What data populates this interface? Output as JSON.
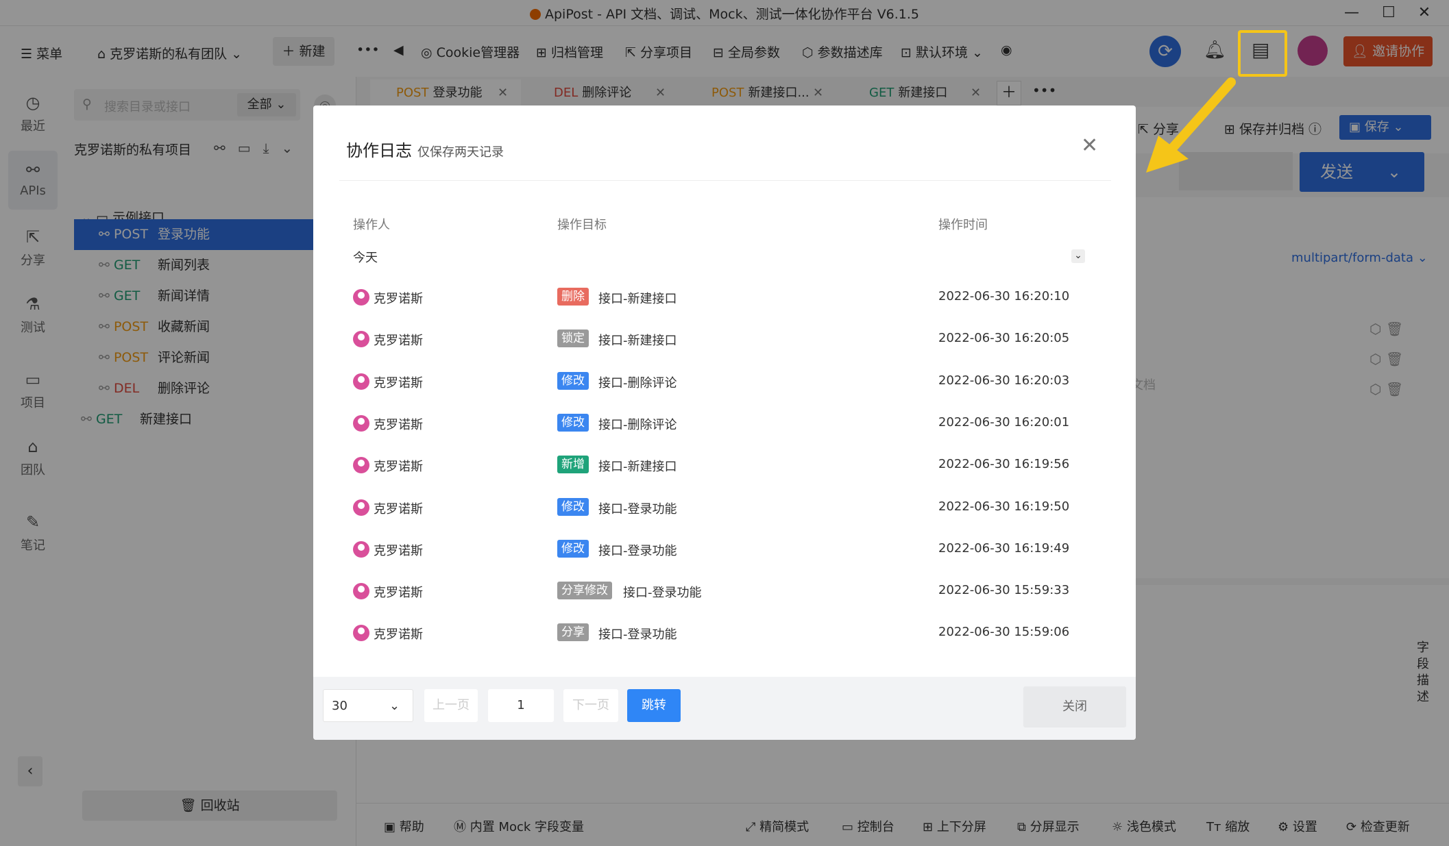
{
  "window": {
    "title": "ApiPost - API 文档、调试、Mock、测试一体化协作平台 V6.1.5",
    "minimize": "—",
    "maximize": "☐",
    "close": "✕"
  },
  "toolbar": {
    "menu": "菜单",
    "team": "克罗诺斯的私有团队",
    "new": "新建",
    "cookie": "Cookie管理器",
    "archive": "归档管理",
    "share": "分享项目",
    "global": "全局参数",
    "paramlib": "参数描述库",
    "env": "默认环境",
    "invite": "邀请协作"
  },
  "rail": [
    "最近",
    "APIs",
    "分享",
    "测试",
    "项目",
    "团队",
    "笔记"
  ],
  "sidebar": {
    "search_placeholder": "搜索目录或接口",
    "filter": "全部",
    "project": "克罗诺斯的私有项目",
    "folder": "示例接口",
    "items": [
      {
        "method": "POST",
        "name": "登录功能"
      },
      {
        "method": "GET",
        "name": "新闻列表"
      },
      {
        "method": "GET",
        "name": "新闻详情"
      },
      {
        "method": "POST",
        "name": "收藏新闻"
      },
      {
        "method": "POST",
        "name": "评论新闻"
      },
      {
        "method": "DEL",
        "name": "删除评论"
      },
      {
        "method": "GET",
        "name": "新建接口"
      }
    ],
    "recycle": "回收站"
  },
  "tabs": [
    {
      "method": "POST",
      "name": "登录功能"
    },
    {
      "method": "DEL",
      "name": "删除评论"
    },
    {
      "method": "POST",
      "name": "新建接口..."
    },
    {
      "method": "GET",
      "name": "新建接口"
    }
  ],
  "main": {
    "share": "分享",
    "save_archive": "保存并归档",
    "save": "保存",
    "send": "发送",
    "content_type": "multipart/form-data",
    "doc_hint": "文档",
    "field_desc": "字段描述"
  },
  "modal": {
    "title": "协作日志",
    "subtitle": "仅保存两天记录",
    "close_x": "✕",
    "col_user": "操作人",
    "col_target": "操作目标",
    "col_time": "操作时间",
    "group": "今天",
    "rows": [
      {
        "user": "克罗诺斯",
        "tag": "删除",
        "tag_color": "#e86b5f",
        "target": "接口-新建接口",
        "time": "2022-06-30 16:20:10"
      },
      {
        "user": "克罗诺斯",
        "tag": "锁定",
        "tag_color": "#9a9a9a",
        "target": "接口-新建接口",
        "time": "2022-06-30 16:20:05"
      },
      {
        "user": "克罗诺斯",
        "tag": "修改",
        "tag_color": "#3b86f0",
        "target": "接口-删除评论",
        "time": "2022-06-30 16:20:03"
      },
      {
        "user": "克罗诺斯",
        "tag": "修改",
        "tag_color": "#3b86f0",
        "target": "接口-删除评论",
        "time": "2022-06-30 16:20:01"
      },
      {
        "user": "克罗诺斯",
        "tag": "新增",
        "tag_color": "#1fa37a",
        "target": "接口-新建接口",
        "time": "2022-06-30 16:19:56"
      },
      {
        "user": "克罗诺斯",
        "tag": "修改",
        "tag_color": "#3b86f0",
        "target": "接口-登录功能",
        "time": "2022-06-30 16:19:50"
      },
      {
        "user": "克罗诺斯",
        "tag": "修改",
        "tag_color": "#3b86f0",
        "target": "接口-登录功能",
        "time": "2022-06-30 16:19:49"
      },
      {
        "user": "克罗诺斯",
        "tag": "分享修改",
        "tag_color": "#9a9a9a",
        "target": "接口-登录功能",
        "time": "2022-06-30 15:59:33"
      },
      {
        "user": "克罗诺斯",
        "tag": "分享",
        "tag_color": "#9a9a9a",
        "target": "接口-登录功能",
        "time": "2022-06-30 15:59:06"
      }
    ],
    "page_size": "30",
    "prev": "上一页",
    "page": "1",
    "next": "下一页",
    "jump": "跳转",
    "close": "关闭"
  },
  "bottom": [
    "帮助",
    "内置 Mock 字段变量",
    "精简模式",
    "控制台",
    "上下分屏",
    "分屏显示",
    "浅色模式",
    "缩放",
    "设置",
    "检查更新"
  ]
}
